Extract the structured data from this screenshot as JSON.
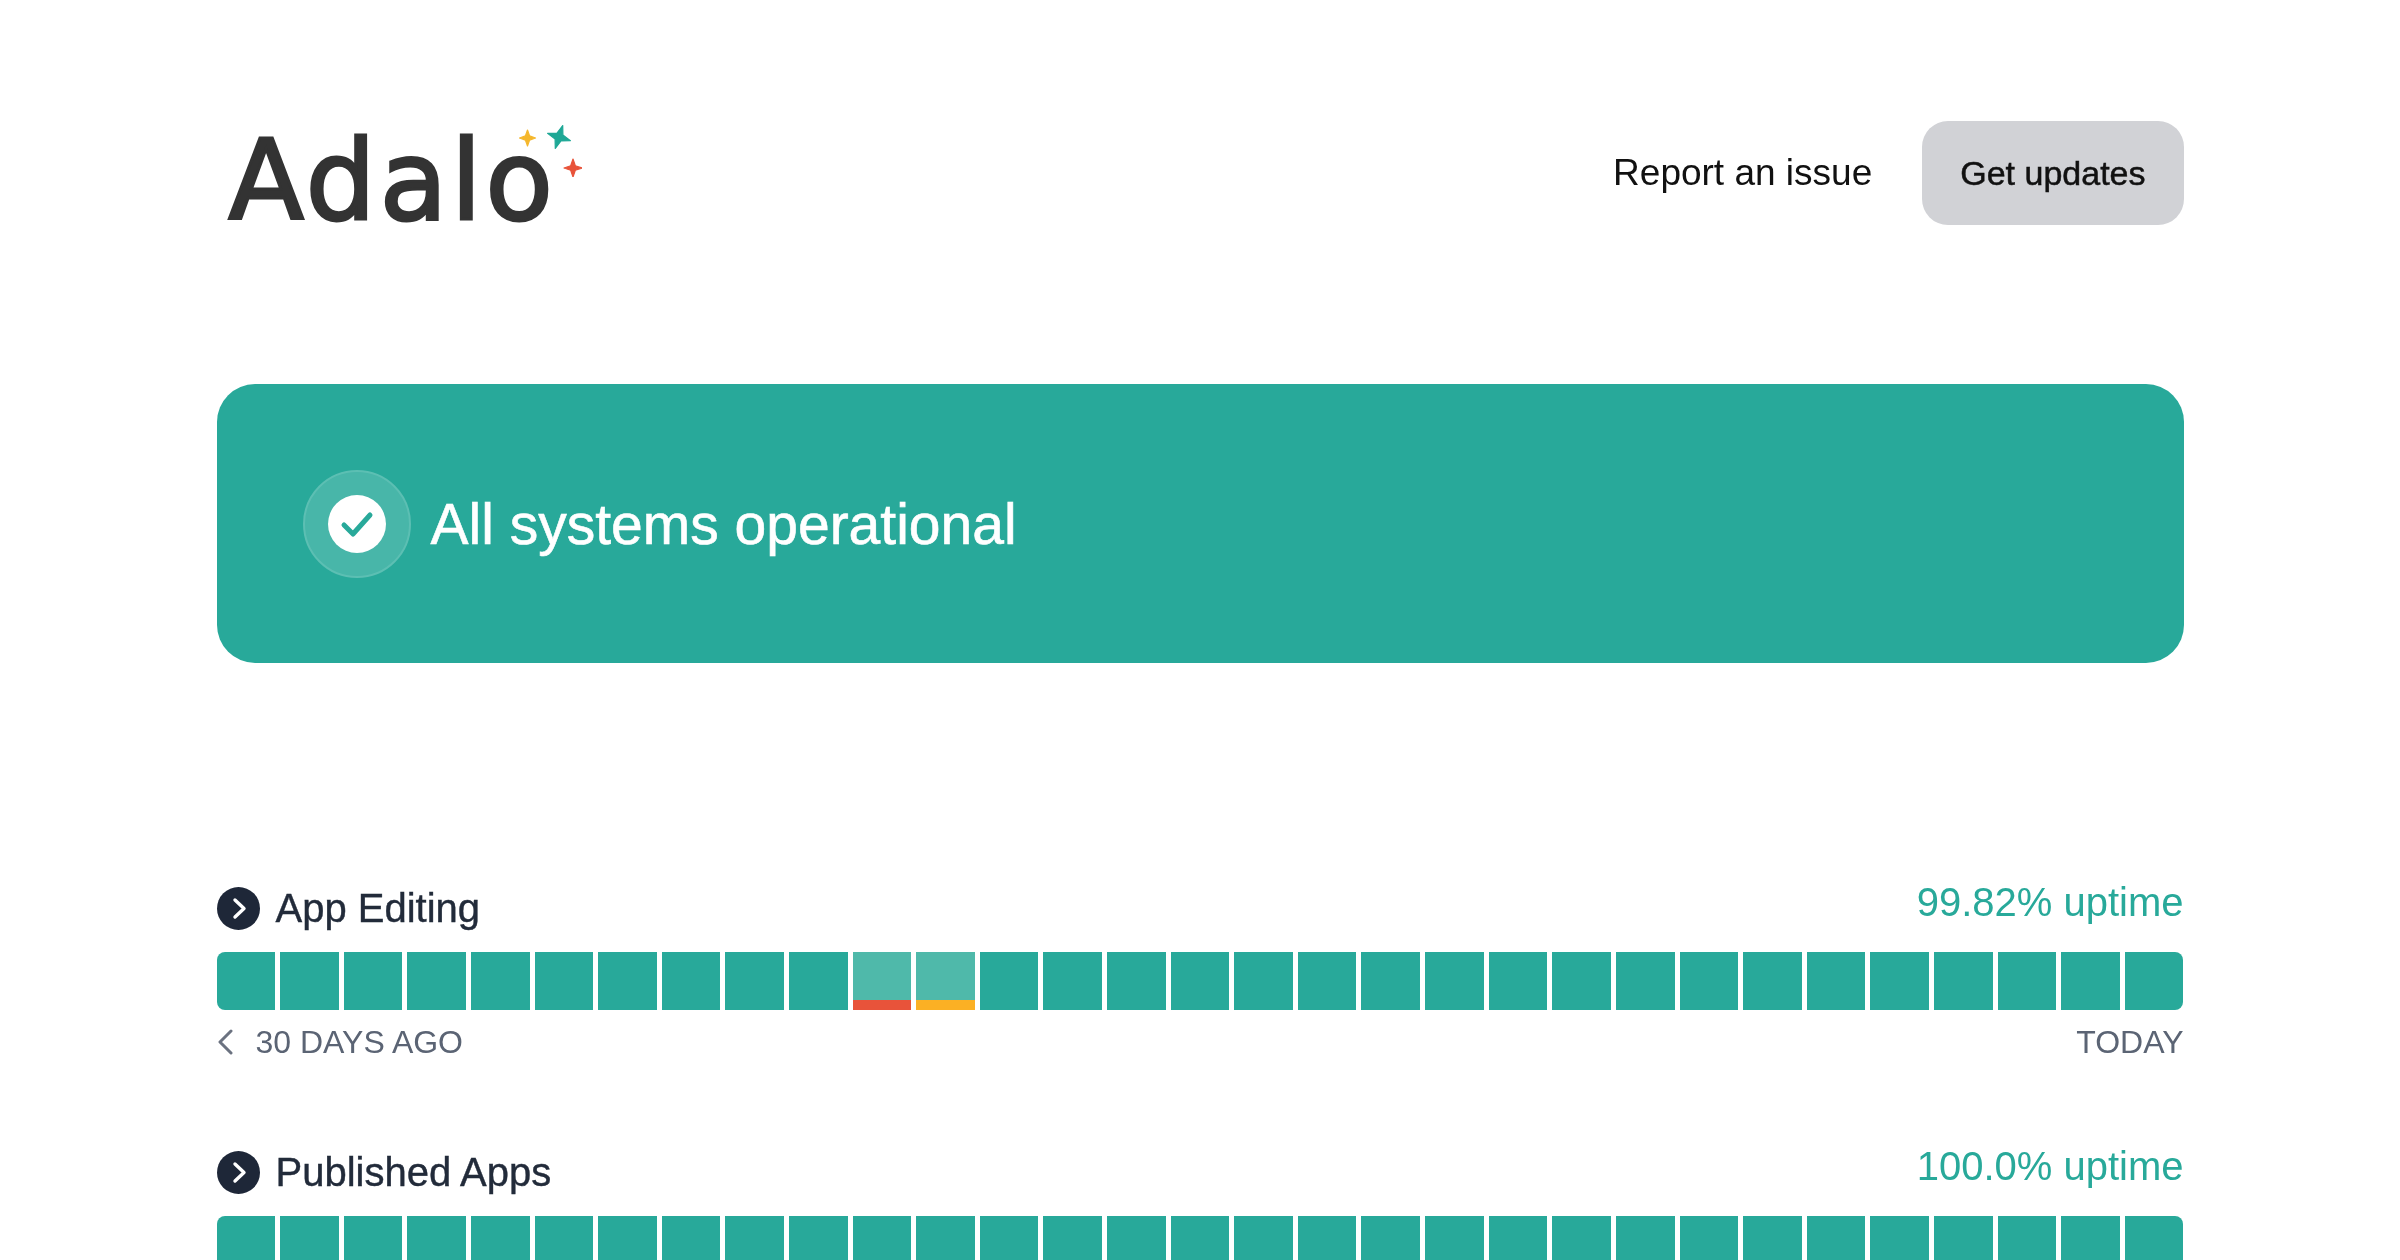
{
  "header": {
    "logo": "Adalo",
    "report_link": "Report an issue",
    "subscribe_button": "Get updates"
  },
  "banner": {
    "text": "All systems operational"
  },
  "components": [
    {
      "name": "App Editing",
      "expanded": false,
      "uptime": "99.82% uptime",
      "days": [
        {
          "kind": "operational"
        },
        {
          "kind": "operational"
        },
        {
          "kind": "operational"
        },
        {
          "kind": "operational"
        },
        {
          "kind": "operational"
        },
        {
          "kind": "operational"
        },
        {
          "kind": "operational"
        },
        {
          "kind": "operational"
        },
        {
          "kind": "operational"
        },
        {
          "kind": "operational"
        },
        {
          "kind": "major"
        },
        {
          "kind": "partial"
        },
        {
          "kind": "operational"
        },
        {
          "kind": "operational"
        },
        {
          "kind": "operational"
        },
        {
          "kind": "operational"
        },
        {
          "kind": "operational"
        },
        {
          "kind": "operational"
        },
        {
          "kind": "operational"
        },
        {
          "kind": "operational"
        },
        {
          "kind": "operational"
        },
        {
          "kind": "operational"
        },
        {
          "kind": "operational"
        },
        {
          "kind": "operational"
        },
        {
          "kind": "operational"
        },
        {
          "kind": "operational"
        },
        {
          "kind": "operational"
        },
        {
          "kind": "operational"
        },
        {
          "kind": "operational"
        },
        {
          "kind": "operational"
        },
        {
          "kind": "operational"
        }
      ],
      "range_start": "30 DAYS AGO",
      "range_end": "TODAY"
    },
    {
      "name": "Published Apps",
      "expanded": false,
      "uptime": "100.0% uptime",
      "days": [
        {
          "kind": "operational"
        },
        {
          "kind": "operational"
        },
        {
          "kind": "operational"
        },
        {
          "kind": "operational"
        },
        {
          "kind": "operational"
        },
        {
          "kind": "operational"
        },
        {
          "kind": "operational"
        },
        {
          "kind": "operational"
        },
        {
          "kind": "operational"
        },
        {
          "kind": "operational"
        },
        {
          "kind": "operational"
        },
        {
          "kind": "operational"
        },
        {
          "kind": "operational"
        },
        {
          "kind": "operational"
        },
        {
          "kind": "operational"
        },
        {
          "kind": "operational"
        },
        {
          "kind": "operational"
        },
        {
          "kind": "operational"
        },
        {
          "kind": "operational"
        },
        {
          "kind": "operational"
        },
        {
          "kind": "operational"
        },
        {
          "kind": "operational"
        },
        {
          "kind": "operational"
        },
        {
          "kind": "operational"
        },
        {
          "kind": "operational"
        },
        {
          "kind": "operational"
        },
        {
          "kind": "operational"
        },
        {
          "kind": "operational"
        },
        {
          "kind": "operational"
        },
        {
          "kind": "operational"
        },
        {
          "kind": "operational"
        }
      ]
    }
  ]
}
